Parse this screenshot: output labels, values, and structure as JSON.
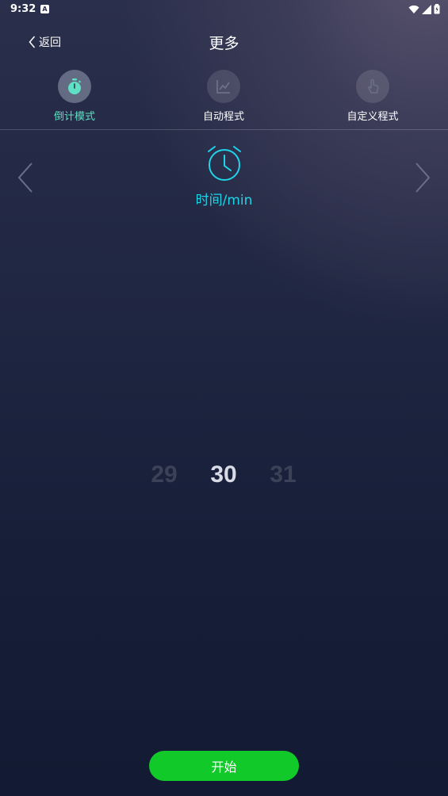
{
  "status_bar": {
    "time": "9:32",
    "notification_icon": "A"
  },
  "header": {
    "back_label": "返回",
    "title": "更多"
  },
  "mode_tabs": [
    {
      "label": "倒计模式",
      "icon": "stopwatch-icon",
      "active": true
    },
    {
      "label": "自动程式",
      "icon": "chart-icon",
      "active": false
    },
    {
      "label": "自定义程式",
      "icon": "hand-pointer-icon",
      "active": false
    }
  ],
  "timer": {
    "icon": "alarm-clock-icon",
    "label": "时间/min"
  },
  "picker": {
    "prev": "29",
    "selected": "30",
    "next": "31"
  },
  "start_button": {
    "label": "开始"
  },
  "colors": {
    "accent_teal": "#5fe0c4",
    "accent_cyan": "#20d4e8",
    "start_green": "#12c92a"
  }
}
